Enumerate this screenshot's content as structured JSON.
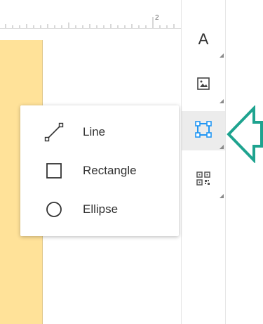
{
  "ruler": {
    "visible_number": "2"
  },
  "toolbar": {
    "tools": [
      {
        "name": "text",
        "glyph": "A",
        "icon": "text-icon"
      },
      {
        "name": "image",
        "icon": "image-icon"
      },
      {
        "name": "shape",
        "icon": "shape-icon",
        "active": true
      },
      {
        "name": "qr-code",
        "icon": "qr-code-icon"
      }
    ]
  },
  "shape_menu": {
    "items": [
      {
        "label": "Line",
        "icon": "line-icon"
      },
      {
        "label": "Rectangle",
        "icon": "rectangle-icon"
      },
      {
        "label": "Ellipse",
        "icon": "ellipse-icon"
      }
    ]
  },
  "colors": {
    "accent": "#2196f3",
    "arrow": "#1ea38f",
    "page": "#ffe299"
  }
}
